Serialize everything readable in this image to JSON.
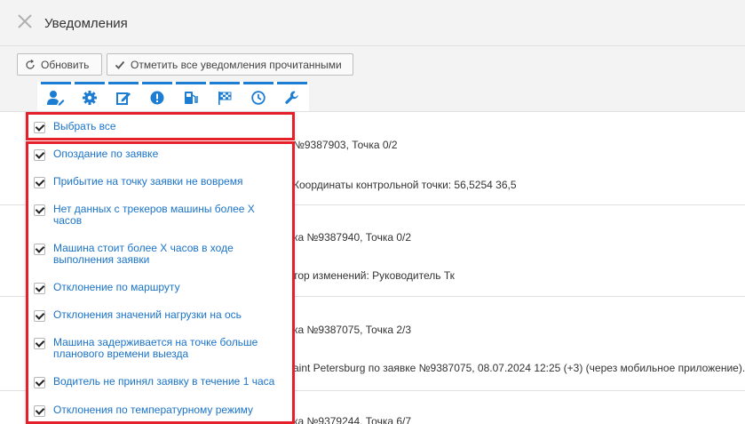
{
  "header": {
    "title": "Уведомления"
  },
  "toolbar": {
    "refresh_label": "Обновить",
    "mark_all_label": "Отметить все уведомления прочитанными"
  },
  "filter_icons": [
    "user-edit-icon",
    "gear-icon",
    "edit-icon",
    "alert-icon",
    "fuel-icon",
    "checkered-flag-icon",
    "clock-icon",
    "wrench-icon"
  ],
  "rows": [
    {
      "line1": "№9387903, Точка 0/2",
      "line2": "Координаты контрольной точки: 56,5254 36,5"
    },
    {
      "line1": "ка №9387940, Точка 0/2",
      "line2": "тор изменений: Руководитель Тк"
    },
    {
      "line1": "ка №9387075, Точка 2/3",
      "line2": "aint Petersburg по заявке №9387075, 08.07.2024 12:25 (+3) (через мобильное приложение)."
    },
    {
      "line1": "ка №9379244, Точка 6/7"
    }
  ],
  "dropdown": {
    "select_all": "Выбрать все",
    "options": [
      "Опоздание по заявке",
      "Прибытие на точку заявки не вовремя",
      "Нет данных с трекеров машины более X часов",
      "Машина стоит более X часов в ходе выполнения заявки",
      "Отклонение по маршруту",
      "Отклонения значений нагрузки на ось",
      "Машина задерживается на точке больше планового времени выезда",
      "Водитель не принял заявку в течение 1 часа",
      "Отклонения по температурному режиму"
    ]
  },
  "colors": {
    "accent": "#1c7dd2",
    "highlight": "#e5202a",
    "link": "#1a73c9"
  }
}
